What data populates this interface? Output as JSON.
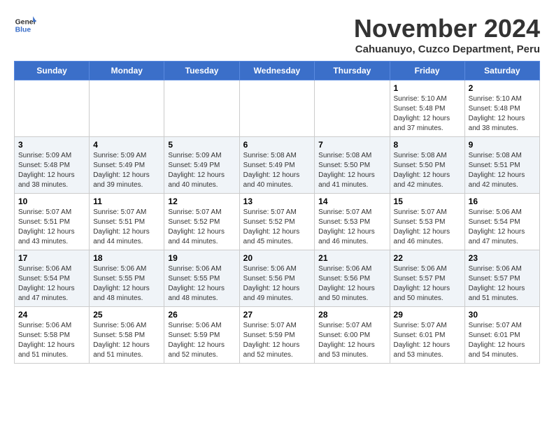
{
  "header": {
    "logo_line1": "General",
    "logo_line2": "Blue",
    "title": "November 2024",
    "location": "Cahuanuyo, Cuzco Department, Peru"
  },
  "weekdays": [
    "Sunday",
    "Monday",
    "Tuesday",
    "Wednesday",
    "Thursday",
    "Friday",
    "Saturday"
  ],
  "weeks": [
    [
      {
        "day": "",
        "info": ""
      },
      {
        "day": "",
        "info": ""
      },
      {
        "day": "",
        "info": ""
      },
      {
        "day": "",
        "info": ""
      },
      {
        "day": "",
        "info": ""
      },
      {
        "day": "1",
        "info": "Sunrise: 5:10 AM\nSunset: 5:48 PM\nDaylight: 12 hours and 37 minutes."
      },
      {
        "day": "2",
        "info": "Sunrise: 5:10 AM\nSunset: 5:48 PM\nDaylight: 12 hours and 38 minutes."
      }
    ],
    [
      {
        "day": "3",
        "info": "Sunrise: 5:09 AM\nSunset: 5:48 PM\nDaylight: 12 hours and 38 minutes."
      },
      {
        "day": "4",
        "info": "Sunrise: 5:09 AM\nSunset: 5:49 PM\nDaylight: 12 hours and 39 minutes."
      },
      {
        "day": "5",
        "info": "Sunrise: 5:09 AM\nSunset: 5:49 PM\nDaylight: 12 hours and 40 minutes."
      },
      {
        "day": "6",
        "info": "Sunrise: 5:08 AM\nSunset: 5:49 PM\nDaylight: 12 hours and 40 minutes."
      },
      {
        "day": "7",
        "info": "Sunrise: 5:08 AM\nSunset: 5:50 PM\nDaylight: 12 hours and 41 minutes."
      },
      {
        "day": "8",
        "info": "Sunrise: 5:08 AM\nSunset: 5:50 PM\nDaylight: 12 hours and 42 minutes."
      },
      {
        "day": "9",
        "info": "Sunrise: 5:08 AM\nSunset: 5:51 PM\nDaylight: 12 hours and 42 minutes."
      }
    ],
    [
      {
        "day": "10",
        "info": "Sunrise: 5:07 AM\nSunset: 5:51 PM\nDaylight: 12 hours and 43 minutes."
      },
      {
        "day": "11",
        "info": "Sunrise: 5:07 AM\nSunset: 5:51 PM\nDaylight: 12 hours and 44 minutes."
      },
      {
        "day": "12",
        "info": "Sunrise: 5:07 AM\nSunset: 5:52 PM\nDaylight: 12 hours and 44 minutes."
      },
      {
        "day": "13",
        "info": "Sunrise: 5:07 AM\nSunset: 5:52 PM\nDaylight: 12 hours and 45 minutes."
      },
      {
        "day": "14",
        "info": "Sunrise: 5:07 AM\nSunset: 5:53 PM\nDaylight: 12 hours and 46 minutes."
      },
      {
        "day": "15",
        "info": "Sunrise: 5:07 AM\nSunset: 5:53 PM\nDaylight: 12 hours and 46 minutes."
      },
      {
        "day": "16",
        "info": "Sunrise: 5:06 AM\nSunset: 5:54 PM\nDaylight: 12 hours and 47 minutes."
      }
    ],
    [
      {
        "day": "17",
        "info": "Sunrise: 5:06 AM\nSunset: 5:54 PM\nDaylight: 12 hours and 47 minutes."
      },
      {
        "day": "18",
        "info": "Sunrise: 5:06 AM\nSunset: 5:55 PM\nDaylight: 12 hours and 48 minutes."
      },
      {
        "day": "19",
        "info": "Sunrise: 5:06 AM\nSunset: 5:55 PM\nDaylight: 12 hours and 48 minutes."
      },
      {
        "day": "20",
        "info": "Sunrise: 5:06 AM\nSunset: 5:56 PM\nDaylight: 12 hours and 49 minutes."
      },
      {
        "day": "21",
        "info": "Sunrise: 5:06 AM\nSunset: 5:56 PM\nDaylight: 12 hours and 50 minutes."
      },
      {
        "day": "22",
        "info": "Sunrise: 5:06 AM\nSunset: 5:57 PM\nDaylight: 12 hours and 50 minutes."
      },
      {
        "day": "23",
        "info": "Sunrise: 5:06 AM\nSunset: 5:57 PM\nDaylight: 12 hours and 51 minutes."
      }
    ],
    [
      {
        "day": "24",
        "info": "Sunrise: 5:06 AM\nSunset: 5:58 PM\nDaylight: 12 hours and 51 minutes."
      },
      {
        "day": "25",
        "info": "Sunrise: 5:06 AM\nSunset: 5:58 PM\nDaylight: 12 hours and 51 minutes."
      },
      {
        "day": "26",
        "info": "Sunrise: 5:06 AM\nSunset: 5:59 PM\nDaylight: 12 hours and 52 minutes."
      },
      {
        "day": "27",
        "info": "Sunrise: 5:07 AM\nSunset: 5:59 PM\nDaylight: 12 hours and 52 minutes."
      },
      {
        "day": "28",
        "info": "Sunrise: 5:07 AM\nSunset: 6:00 PM\nDaylight: 12 hours and 53 minutes."
      },
      {
        "day": "29",
        "info": "Sunrise: 5:07 AM\nSunset: 6:01 PM\nDaylight: 12 hours and 53 minutes."
      },
      {
        "day": "30",
        "info": "Sunrise: 5:07 AM\nSunset: 6:01 PM\nDaylight: 12 hours and 54 minutes."
      }
    ]
  ]
}
